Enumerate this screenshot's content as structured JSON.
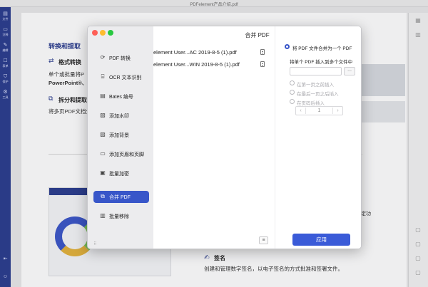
{
  "app": {
    "window_title": "PDFelement产品介绍.pdf"
  },
  "rail": {
    "items": [
      {
        "label": "文件",
        "icon": "file-icon"
      },
      {
        "label": "注释",
        "icon": "comment-icon"
      },
      {
        "label": "编辑",
        "icon": "edit-icon"
      },
      {
        "label": "表单",
        "icon": "form-icon"
      },
      {
        "label": "保护",
        "icon": "protect-icon"
      },
      {
        "label": "工具",
        "icon": "tools-icon"
      }
    ]
  },
  "document": {
    "heading": "转换和提取",
    "section1_title": "格式转换",
    "section1_line1": "单个或批量将P",
    "section1_line2": "PowerPoint®、H",
    "section2_title": "拆分和提取",
    "section2_line1": "将多页PDF文档分",
    "right_fragment": "定功",
    "sign_title": "签名",
    "sign_desc": "创建和管理数字签名，以电子签名的方式批准和签署文件。"
  },
  "dialog": {
    "title": "合并 PDF",
    "nav": [
      {
        "label": "PDF 转换",
        "icon": "convert-icon",
        "active": false
      },
      {
        "label": "OCR 文本识别",
        "icon": "ocr-icon",
        "active": false
      },
      {
        "label": "Bates 编号",
        "icon": "bates-icon",
        "active": false
      },
      {
        "label": "添加水印",
        "icon": "watermark-icon",
        "active": false
      },
      {
        "label": "添加背景",
        "icon": "background-icon",
        "active": false
      },
      {
        "label": "添加页眉和页脚",
        "icon": "header-footer-icon",
        "active": false
      },
      {
        "label": "批量加密",
        "icon": "encrypt-icon",
        "active": false
      },
      {
        "label": "合并 PDF",
        "icon": "merge-icon",
        "active": true
      },
      {
        "label": "批量移除",
        "icon": "remove-icon",
        "active": false
      }
    ],
    "files": [
      "element User...AC 2019-8-5 (1).pdf",
      "element User...WIN 2019-8-5 (1).pdf"
    ],
    "options": {
      "merge_into_one": "将 PDF 文件合并为一个 PDF",
      "insert_into_multiple": "将单个 PDF 插入到多个文件中",
      "browse_label": "...",
      "before_first": "在第一页之前插入",
      "after_last": "在最后一页之后插入",
      "after_page": "在页码后插入",
      "page_value": "1",
      "stepper_minus": "‹",
      "stepper_plus": "›"
    },
    "list_button": "≡",
    "apply": "应用"
  }
}
